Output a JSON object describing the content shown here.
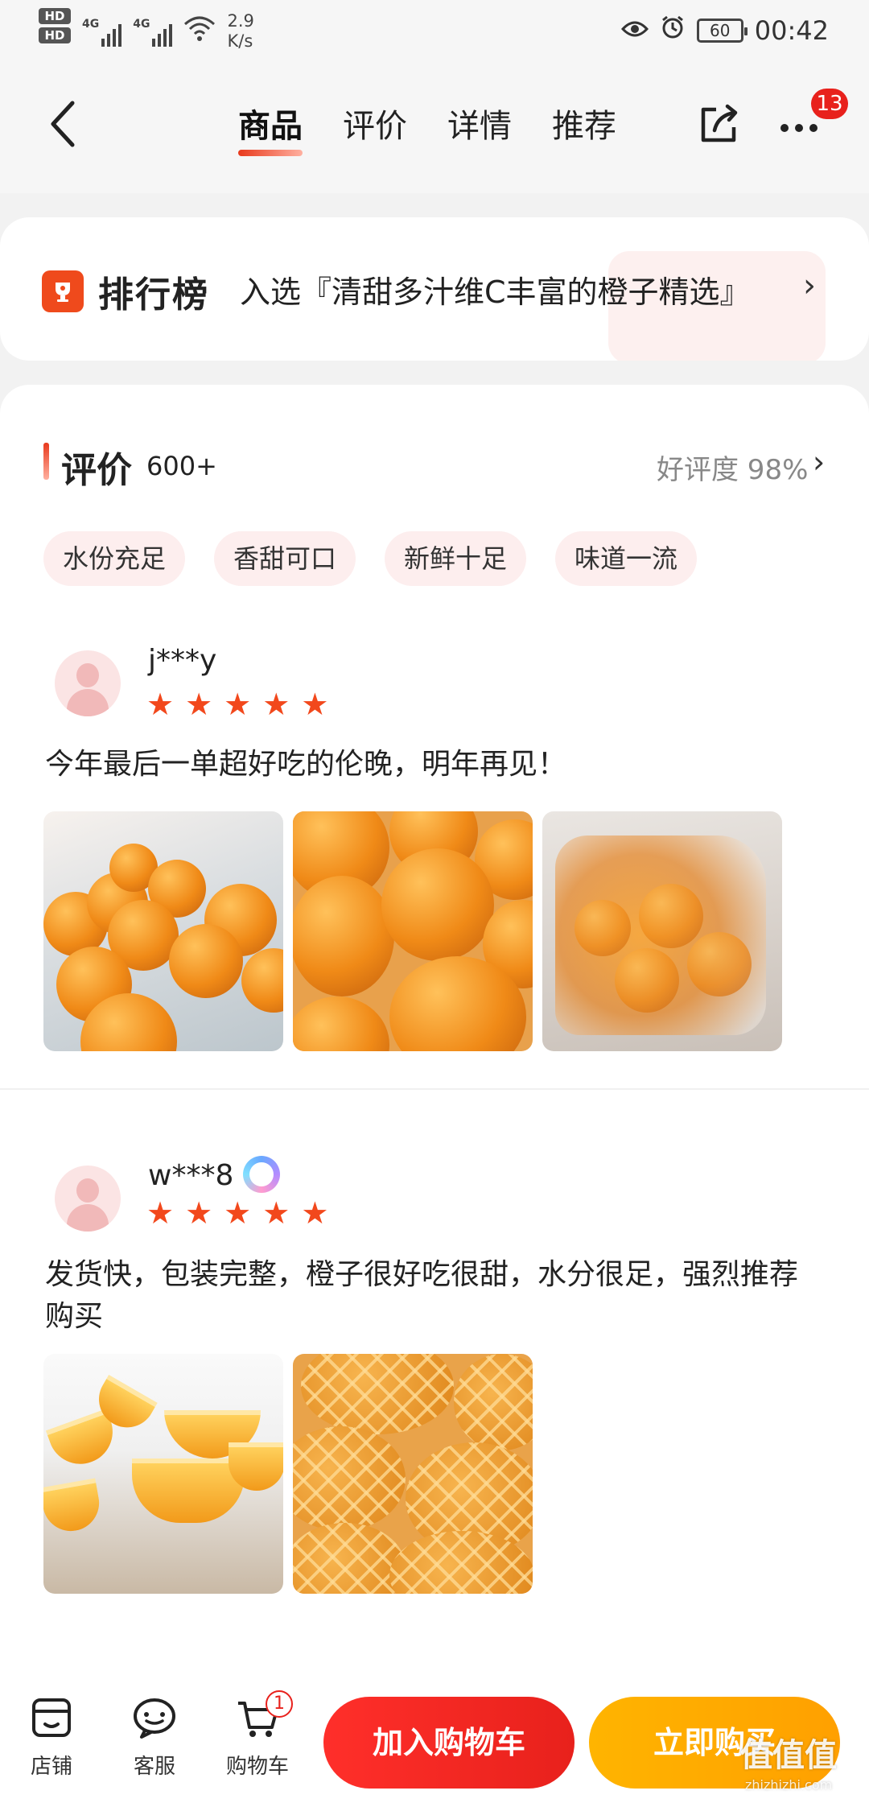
{
  "status_bar": {
    "hd_1": "HD",
    "hd_2": "HD",
    "net_1": "4G",
    "net_2": "4G",
    "speed_value": "2.9",
    "speed_unit": "K/s",
    "battery": "60",
    "time": "00:42"
  },
  "nav": {
    "tabs": [
      {
        "label": "商品",
        "active": true
      },
      {
        "label": "评价",
        "active": false
      },
      {
        "label": "详情",
        "active": false
      },
      {
        "label": "推荐",
        "active": false
      }
    ],
    "message_count": "13"
  },
  "ranking": {
    "title": "排行榜",
    "text": "入选『清甜多汁维C丰富的橙子精选』",
    "chevron": "›"
  },
  "reviews": {
    "title": "评价",
    "count": "600+",
    "rating": "好评度 98%",
    "chevron": "›",
    "tags": [
      "水份充足",
      "香甜可口",
      "新鲜十足",
      "味道一流"
    ],
    "items": [
      {
        "username": "j***y",
        "stars": 5,
        "text": "今年最后一单超好吃的伦晚，明年再见！",
        "photo_count": 3
      },
      {
        "username": "w***8",
        "stars": 5,
        "vip": true,
        "text": "发货快，包装完整，橙子很好吃很甜，水分很足，强烈推荐购买",
        "photo_count": 2
      }
    ]
  },
  "bottom_bar": {
    "shop_label": "店铺",
    "service_label": "客服",
    "cart_label": "购物车",
    "cart_count": "1",
    "add_to_cart": "加入购物车",
    "buy_now": "立即购买"
  },
  "watermark": {
    "logo": "值值值",
    "site": "zhizhizhi.com"
  },
  "colors": {
    "accent_red": "#e8211c",
    "star_orange": "#f2481c",
    "buy_yellow": "#ffa000",
    "tag_bg": "#fdeeee"
  }
}
